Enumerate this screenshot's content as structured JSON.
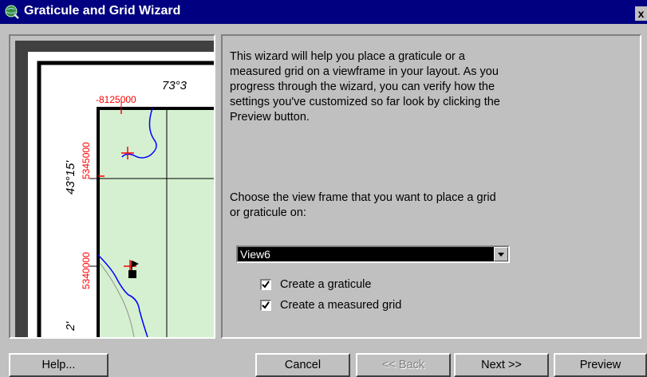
{
  "window": {
    "title": "Graticule and Grid Wizard",
    "close_label": "x",
    "title_icon": "globe-icon"
  },
  "preview": {
    "graticule_top_label": "73°3",
    "graticule_left_label": "43°15'",
    "graticule_left_label2": "2'",
    "grid_top_label": "-8125000",
    "grid_left_upper": "5345000",
    "grid_left_lower": "5340000",
    "colors": {
      "map_fill": "#d4f0d0",
      "grid_label": "#ff0000",
      "river": "#0000ff",
      "cross": "#ff0000"
    }
  },
  "content": {
    "description": "This wizard will help you place a graticule or a measured grid on a viewframe in your layout. As you progress through the wizard, you can verify how the settings you've customized so far look by clicking the Preview button.",
    "choose_prompt": "Choose the view frame that you want to place a grid or graticule on:",
    "view_frame_selected": "View6",
    "checkboxes": [
      {
        "label": "Create a graticule",
        "checked": true
      },
      {
        "label": "Create a measured grid",
        "checked": true
      }
    ]
  },
  "buttons": {
    "help": "Help...",
    "cancel": "Cancel",
    "back": "<< Back",
    "next": "Next >>",
    "preview": "Preview"
  }
}
